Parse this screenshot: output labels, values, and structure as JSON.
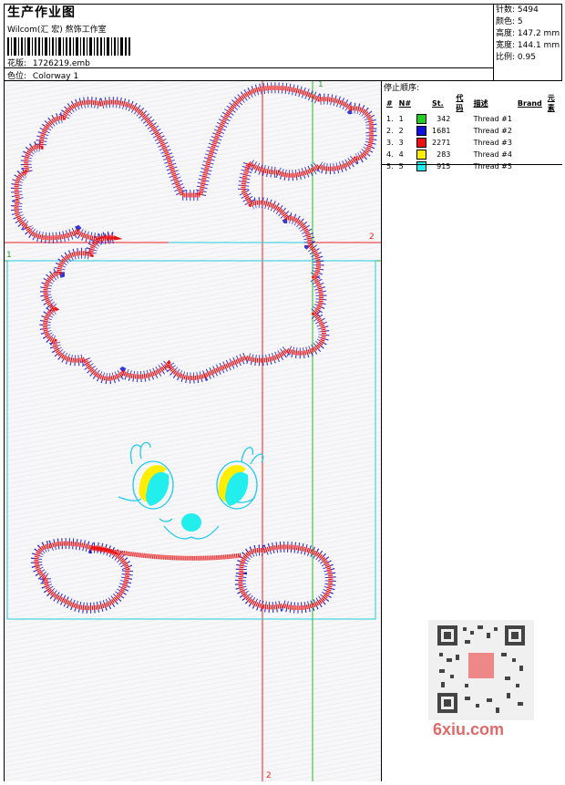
{
  "header": {
    "title": "生产作业图",
    "company": "Wilcom(汇 宏) 熬饰工作室",
    "file_label": "花版:",
    "file_value": "1726219.emb",
    "colorway_label": "色位:",
    "colorway_value": "Colorway 1"
  },
  "stats": [
    {
      "label": "针数:",
      "value": "5494"
    },
    {
      "label": "颜色:",
      "value": "5"
    },
    {
      "label": "高度:",
      "value": "147.2 mm"
    },
    {
      "label": "宽度:",
      "value": "144.1 mm"
    },
    {
      "label": "比例:",
      "value": "0.95"
    }
  ],
  "stop_sequence": {
    "title": "停止顺序:",
    "headers": [
      "#",
      "N#",
      "St.",
      "代码",
      "描述",
      "Brand",
      "元素"
    ],
    "rows": [
      {
        "num": "1.",
        "n": "1",
        "color": "#22cc22",
        "stitches": "342",
        "desc": "Thread #1"
      },
      {
        "num": "2.",
        "n": "2",
        "color": "#1111dd",
        "stitches": "1681",
        "desc": "Thread #2"
      },
      {
        "num": "3.",
        "n": "3",
        "color": "#ee1111",
        "stitches": "2271",
        "desc": "Thread #3"
      },
      {
        "num": "4.",
        "n": "4",
        "color": "#ffee00",
        "stitches": "283",
        "desc": "Thread #4"
      },
      {
        "num": "5.",
        "n": "5",
        "color": "#22eeee",
        "stitches": "915",
        "desc": "Thread #5"
      }
    ]
  },
  "markers": {
    "top_green": "1",
    "left_green": "1",
    "right_red": "2",
    "bottom_red": "2"
  },
  "watermark": "6xiu.com"
}
